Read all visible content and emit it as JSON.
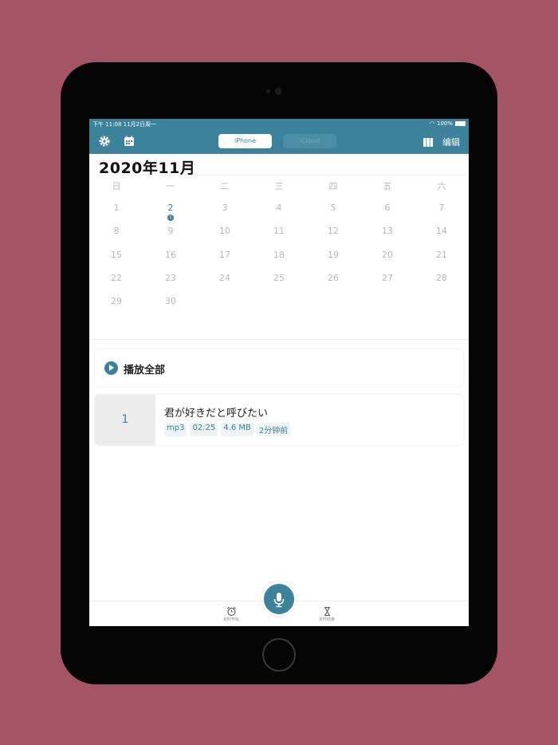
{
  "status_bar": {
    "time_date": "下午 11:08   11月2日周一",
    "battery": "100%"
  },
  "toolbar": {
    "segments": [
      "iPhone",
      "iCloud"
    ],
    "selected_segment": "iPhone",
    "edit_label": "编辑",
    "icons": [
      "gear-icon",
      "calendar-icon",
      "book-icon"
    ]
  },
  "calendar": {
    "month_title": "2020年11月",
    "weekdays": [
      "日",
      "一",
      "二",
      "三",
      "四",
      "五",
      "六"
    ],
    "weeks": [
      [
        "1",
        "2",
        "3",
        "4",
        "5",
        "6",
        "7"
      ],
      [
        "8",
        "9",
        "10",
        "11",
        "12",
        "13",
        "14"
      ],
      [
        "15",
        "16",
        "17",
        "18",
        "19",
        "20",
        "21"
      ],
      [
        "22",
        "23",
        "24",
        "25",
        "26",
        "27",
        "28"
      ],
      [
        "29",
        "30",
        "",
        "",
        "",
        "",
        ""
      ]
    ],
    "highlighted_day": "2",
    "highlighted_day_count": "1"
  },
  "play_all": {
    "label": "播放全部"
  },
  "recordings": [
    {
      "index": "1",
      "title": "君が好きだと呼びたい",
      "format": "mp3",
      "duration": "02:25",
      "size": "4.6 MB",
      "time_ago": "2分钟前"
    }
  ],
  "bottom_bar": {
    "timer_start_label": "定时开始",
    "timer_end_label": "定时结束"
  },
  "colors": {
    "accent": "#3c829b",
    "background": "#a35566",
    "device": "#050505"
  }
}
